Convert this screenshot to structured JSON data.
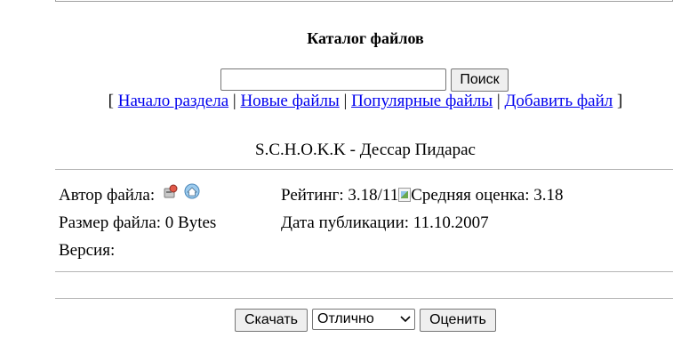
{
  "header": {
    "title": "Каталог файлов"
  },
  "search": {
    "value": "",
    "button_label": "Поиск"
  },
  "nav": {
    "open_bracket": "[",
    "close_bracket": "]",
    "separator": "|",
    "links": [
      "Начало раздела",
      "Новые файлы",
      "Популярные файлы",
      "Добавить файл"
    ]
  },
  "file": {
    "name": "S.C.H.O.K.K - Дессар Пидарас",
    "author_label": "Автор файла:",
    "size_label": "Размер файла: 0 Bytes",
    "version_label": "Версия:",
    "rating_label": "Рейтинг: 3.18/11",
    "rating_image_alt": "Средняя оценка: 3.18",
    "date_label": "Дата публикации: 11.10.2007"
  },
  "actions": {
    "download_label": "Скачать",
    "vote_selected": "Отлично",
    "vote_button_label": "Оценить"
  },
  "icons": [
    "profile-icon",
    "homepage-icon",
    "chevron-down-icon",
    "broken-image-icon"
  ]
}
